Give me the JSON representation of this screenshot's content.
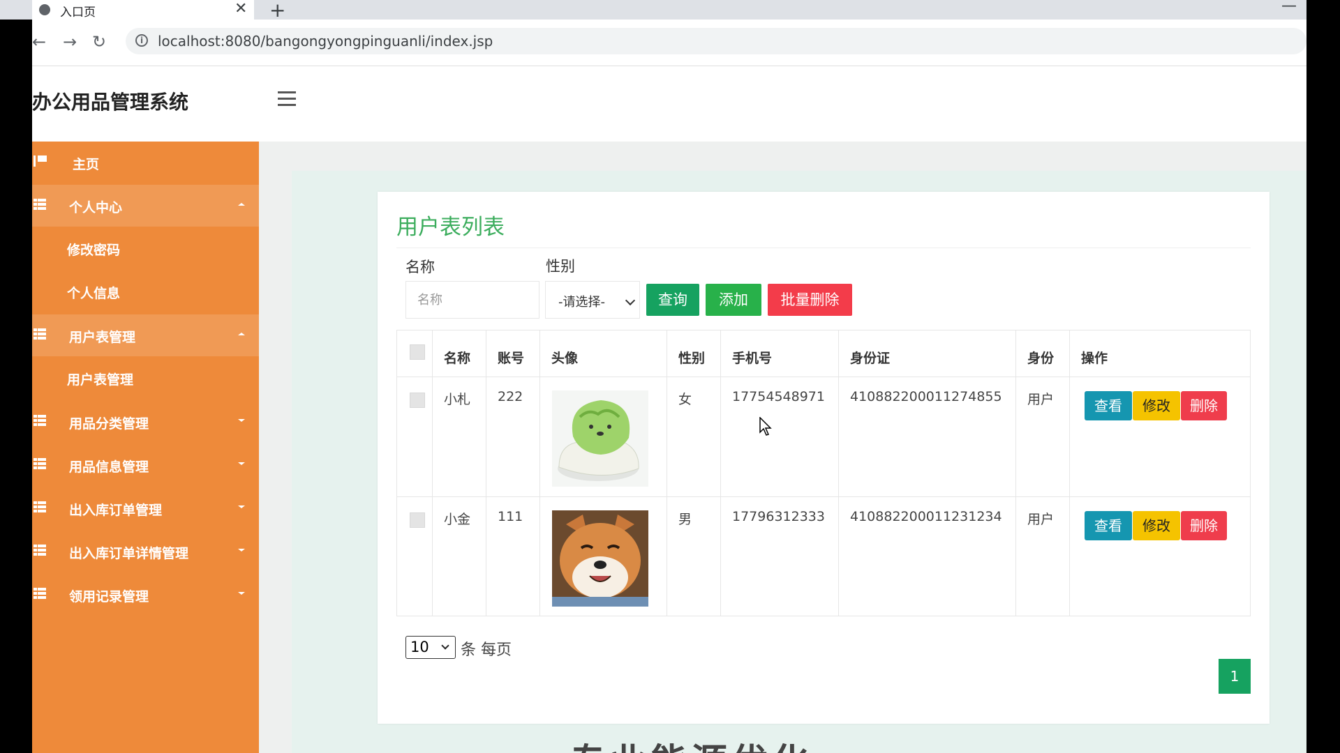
{
  "browser": {
    "tab_title": "入口页",
    "url": "localhost:8080/bangongyongpinguanli/index.jsp"
  },
  "app": {
    "title": "办公用品管理系统"
  },
  "sidebar": {
    "home": "主页",
    "personal_center": "个人中心",
    "personal_sub": [
      "修改密码",
      "个人信息"
    ],
    "user_mgmt": "用户表管理",
    "user_sub": [
      "用户表管理"
    ],
    "collapsed": [
      "用品分类管理",
      "用品信息管理",
      "出入库订单管理",
      "出入库订单详情管理",
      "领用记录管理"
    ]
  },
  "page": {
    "title": "用户表列表",
    "filter_name_label": "名称",
    "filter_name_placeholder": "名称",
    "filter_gender_label": "性别",
    "filter_gender_value": "-请选择-",
    "btn_query": "查询",
    "btn_add": "添加",
    "btn_batch_delete": "批量删除"
  },
  "table": {
    "headers": [
      "名称",
      "账号",
      "头像",
      "性别",
      "手机号",
      "身份证",
      "身份",
      "操作"
    ],
    "rows": [
      {
        "name": "小札",
        "account": "222",
        "gender": "女",
        "phone": "17754548971",
        "id_card": "410882200011274855",
        "role": "用户"
      },
      {
        "name": "小金",
        "account": "111",
        "gender": "男",
        "phone": "17796312333",
        "id_card": "410882200011231234",
        "role": "用户"
      }
    ],
    "actions": {
      "view": "查看",
      "edit": "修改",
      "delete": "删除"
    }
  },
  "pagination": {
    "page_size": "10",
    "per_page_label": "条 每页",
    "current_page": "1"
  },
  "footer_partial_text": "专业能源优化",
  "colors": {
    "sidebar": "#ee8a3a",
    "title_green": "#3cad5d",
    "primary_green": "#16a260",
    "danger": "#f33c4a",
    "info": "#1596b0",
    "warning": "#f5c300"
  }
}
